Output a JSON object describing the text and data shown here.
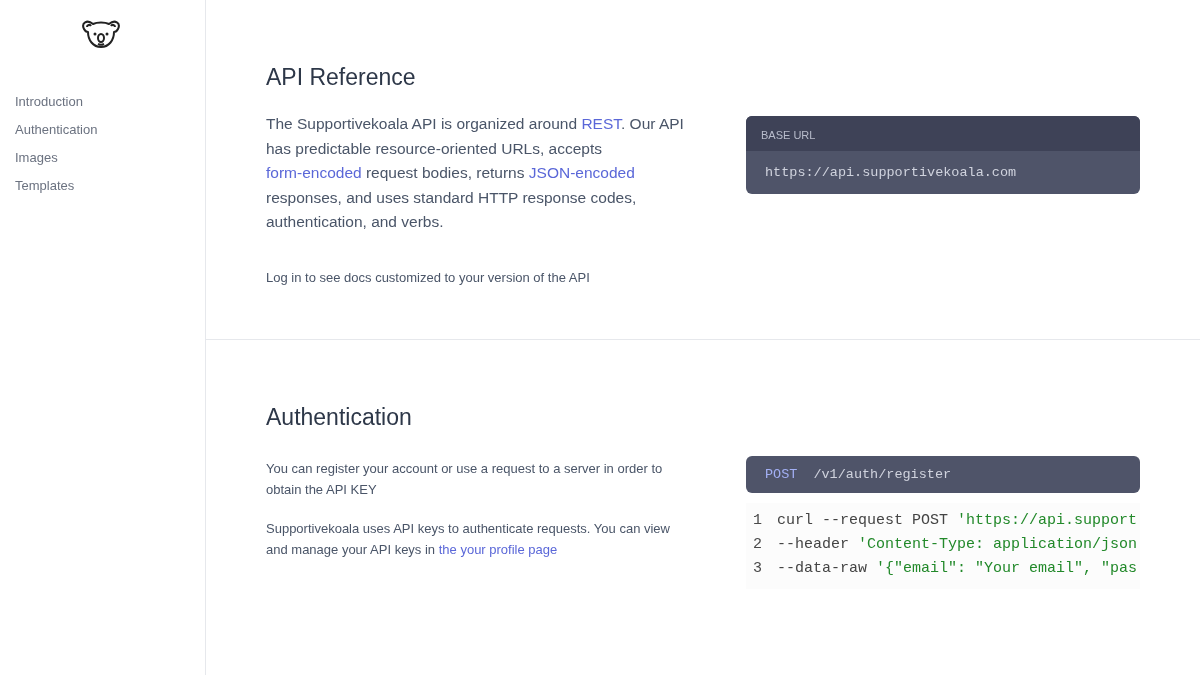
{
  "sidebar": {
    "items": [
      {
        "label": "Introduction"
      },
      {
        "label": "Authentication"
      },
      {
        "label": "Images"
      },
      {
        "label": "Templates"
      }
    ]
  },
  "sections": [
    {
      "title": "API Reference",
      "paragraphs": [
        {
          "kind": "large",
          "parts": [
            {
              "kind": "text",
              "text": "The Supportivekoala API is organized around "
            },
            {
              "kind": "link",
              "text": "REST"
            },
            {
              "kind": "text",
              "text": ". Our API has predictable resource-oriented URLs, accepts "
            },
            {
              "kind": "link",
              "text": "form-encoded"
            },
            {
              "kind": "text",
              "text": " request bodies, returns "
            },
            {
              "kind": "link",
              "text": "JSON-encoded"
            },
            {
              "kind": "text",
              "text": " responses, and uses standard HTTP response codes, authentication, and verbs."
            }
          ]
        },
        {
          "kind": "small",
          "parts": [
            {
              "kind": "text",
              "text": "Log in to see docs customized to your version of the API"
            }
          ]
        }
      ],
      "panel": {
        "kind": "base_url",
        "label": "BASE URL",
        "value": "https://api.supportivekoala.com"
      }
    },
    {
      "title": "Authentication",
      "paragraphs": [
        {
          "kind": "small",
          "parts": [
            {
              "kind": "text",
              "text": "You can register your account or use a request to a server in order to obtain the API KEY"
            }
          ]
        },
        {
          "kind": "small",
          "parts": [
            {
              "kind": "text",
              "text": "Supportivekoala uses API keys to authenticate requests. You can view and manage your API keys in "
            },
            {
              "kind": "link",
              "text": "the your profile page"
            }
          ]
        }
      ],
      "panel": {
        "kind": "endpoint",
        "method": "POST",
        "path": "/v1/auth/register",
        "code": [
          {
            "number": "1",
            "tokens": [
              {
                "kind": "plain",
                "text": "curl --request POST "
              },
              {
                "kind": "string",
                "text": "'https://api.support"
              }
            ]
          },
          {
            "number": "2",
            "tokens": [
              {
                "kind": "plain",
                "text": "--header "
              },
              {
                "kind": "string",
                "text": "'Content-Type: application/json"
              }
            ]
          },
          {
            "number": "3",
            "tokens": [
              {
                "kind": "plain",
                "text": "--data-raw "
              },
              {
                "kind": "string",
                "text": "'{\"email\": \"Your email\", \"pas"
              }
            ]
          }
        ]
      }
    }
  ]
}
